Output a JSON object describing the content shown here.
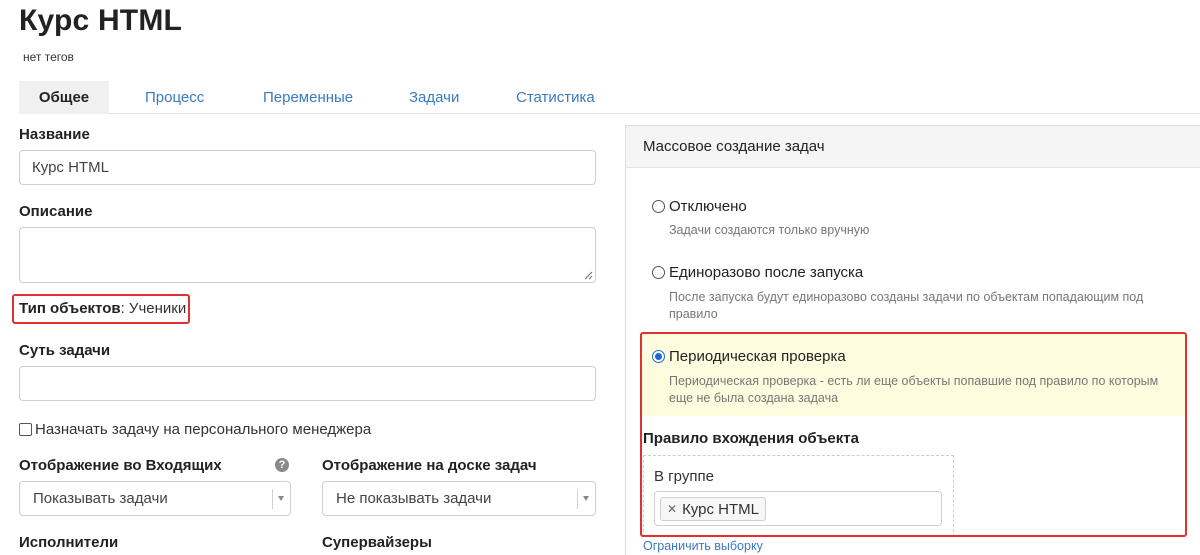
{
  "header": {
    "title": "Курс HTML",
    "tags": "нет тегов"
  },
  "tabs": [
    {
      "label": "Общее",
      "active": true
    },
    {
      "label": "Процесс"
    },
    {
      "label": "Переменные"
    },
    {
      "label": "Задачи"
    },
    {
      "label": "Статистика"
    }
  ],
  "form": {
    "name_label": "Название",
    "name_value": "Курс HTML",
    "description_label": "Описание",
    "description_value": "",
    "object_type_label": "Тип объектов",
    "object_type_value": ": Ученики",
    "task_essence_label": "Суть задачи",
    "task_essence_value": "",
    "assign_manager_label": "Назначать задачу на персонального менеджера",
    "assign_manager_checked": false,
    "inbox_display_label": "Отображение во Входящих",
    "inbox_display_value": "Показывать задачи",
    "board_display_label": "Отображение на доске задач",
    "board_display_value": "Не показывать задачи",
    "executors_label": "Исполнители",
    "supervisors_label": "Супервайзеры"
  },
  "mass_creation": {
    "title": "Массовое создание задач",
    "options": [
      {
        "label": "Отключено",
        "desc": "Задачи создаются только вручную",
        "checked": false
      },
      {
        "label": "Единоразово после запуска",
        "desc": "После запуска будут единоразово созданы задачи по объектам попадающим под правило",
        "checked": false
      },
      {
        "label": "Периодическая проверка",
        "desc": "Периодическая проверка - есть ли еще объекты попавшие под правило по которым еще не была создана задача",
        "checked": true
      }
    ],
    "rule_title": "Правило вхождения объекта",
    "group_label": "В группе",
    "group_chip": "Курс HTML",
    "limit_link": "Ограничить выборку"
  },
  "colors": {
    "link": "#3a7ac0",
    "highlight": "#fdfcde",
    "annotation_red": "#e03030"
  },
  "icons": {
    "help": "question-circle-icon",
    "select_caret": "caret-down-icon",
    "chip_remove": "close-icon"
  }
}
